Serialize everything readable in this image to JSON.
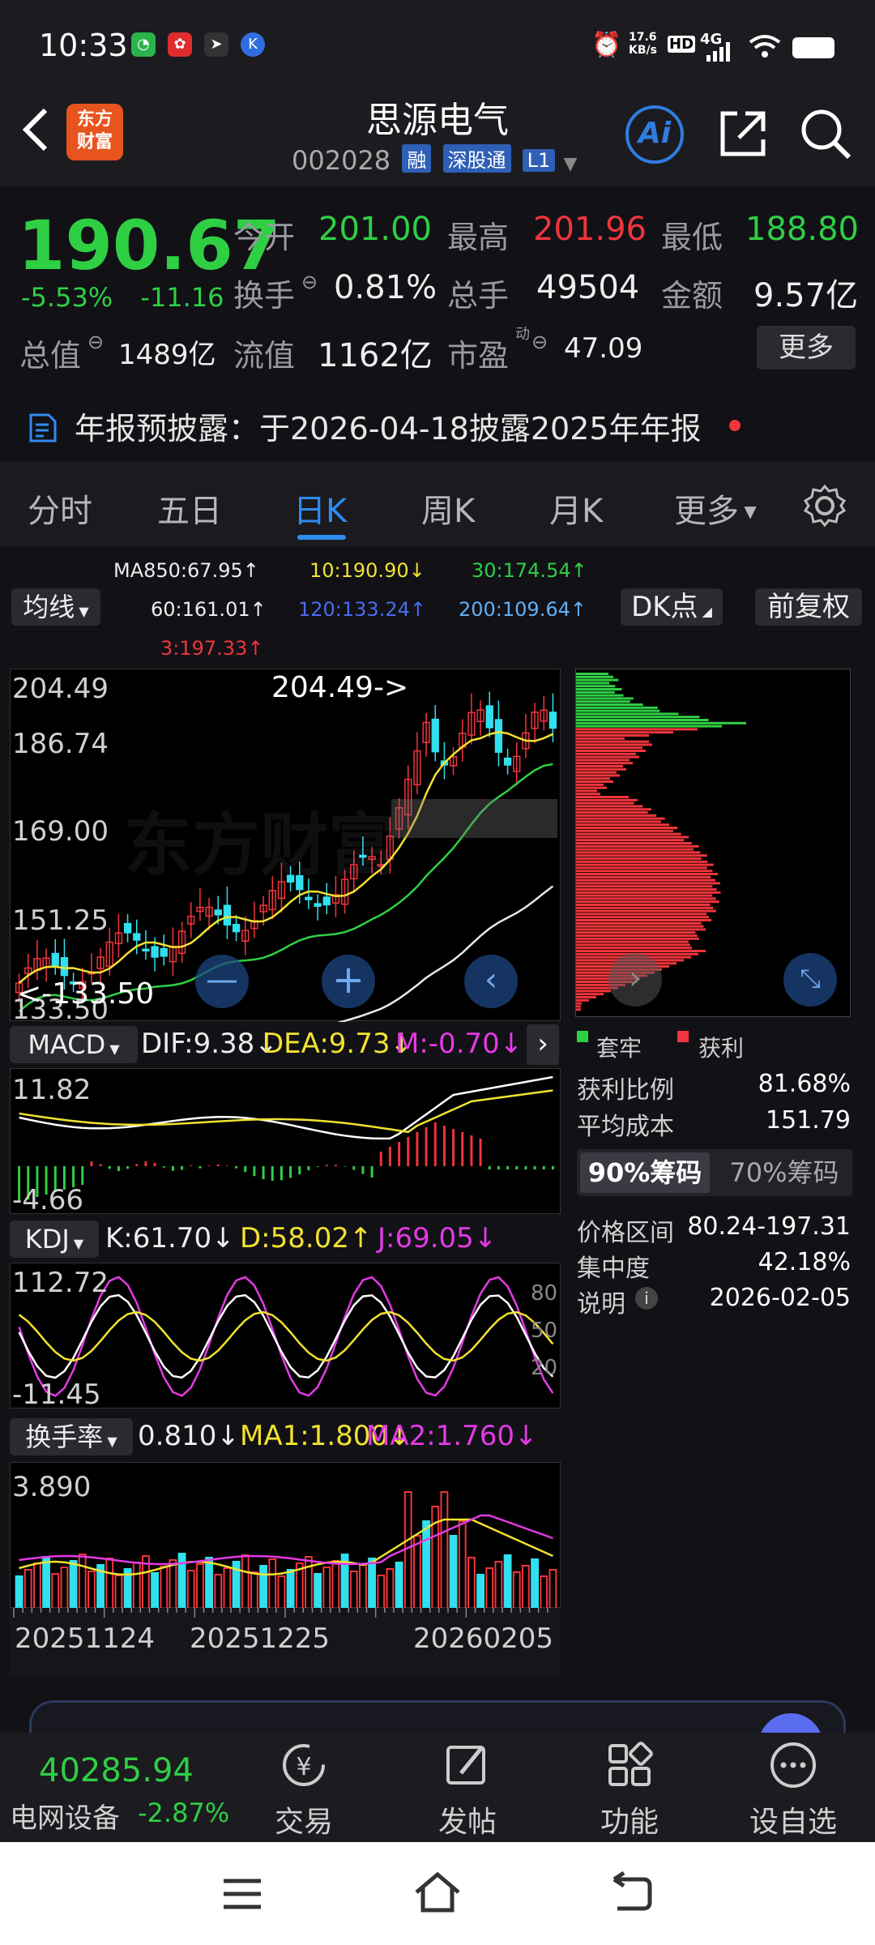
{
  "status_bar": {
    "time": "10:33",
    "net_speed": "17.6\nKB/s",
    "hd": "HD",
    "signal": "4G"
  },
  "header": {
    "logo_text": "东方\n财富",
    "title": "思源电气",
    "code": "002028",
    "tags": [
      "融",
      "深股通",
      "L1"
    ],
    "ai_label": "Ai"
  },
  "quote": {
    "price": "190.67",
    "change_pct": "-5.53%",
    "change_amt": "-11.16",
    "open_label": "今开",
    "open": "201.00",
    "high_label": "最高",
    "high": "201.96",
    "low_label": "最低",
    "low": "188.80",
    "turnover_label": "换手",
    "turnover": "0.81%",
    "volume_label": "总手",
    "volume": "49504",
    "amount_label": "金额",
    "amount": "9.57亿",
    "mktcap_label": "总值",
    "mktcap": "1489亿",
    "float_label": "流值",
    "float_cap": "1162亿",
    "pe_label": "市盈",
    "pe_sup": "动",
    "pe": "47.09",
    "more_label": "更多"
  },
  "announcement": {
    "text": "年报预披露：于2026-04-18披露2025年年报"
  },
  "tabs": [
    "分时",
    "五日",
    "日K",
    "周K",
    "月K",
    "更多"
  ],
  "active_tab": "日K",
  "ma_row": {
    "ma_select": "均线",
    "ma850": "MA850:67.95↑",
    "ma10": "10:190.90↓",
    "ma30": "30:174.54↑",
    "ma60": "60:161.01↑",
    "ma120": "120:133.24↑",
    "ma200": "200:109.64↑",
    "ma3": "3:197.33↑",
    "dk_label": "DK点",
    "adjust_label": "前复权"
  },
  "kline": {
    "y_labels": [
      "204.49",
      "186.74",
      "169.00",
      "151.25",
      "133.50"
    ],
    "max_marker": "204.49->",
    "min_marker": "<-133.50",
    "watermark": "东方财富"
  },
  "macd": {
    "name": "MACD",
    "dif": "DIF:9.38↓",
    "dea": "DEA:9.73↓",
    "m": "M:-0.70↓",
    "y_top": "11.82",
    "y_bottom": "-4.66"
  },
  "kdj": {
    "name": "KDJ",
    "k": "K:61.70↓",
    "d": "D:58.02↑",
    "j": "J:69.05↓",
    "y_top": "112.72",
    "y_bottom": "-11.45",
    "levels": [
      "80",
      "50",
      "20"
    ]
  },
  "turnover_ind": {
    "name": "换手率",
    "val": "0.810↓",
    "ma1": "MA1:1.800↓",
    "ma2": "MA2:1.760↓",
    "y_top": "3.890"
  },
  "dates": [
    "20251124",
    "20251225",
    "20260205"
  ],
  "chips": {
    "legend_trapped": "套牢",
    "legend_profit": "获利",
    "rows": [
      {
        "k": "获利比例",
        "v": "81.68%"
      },
      {
        "k": "平均成本",
        "v": "151.79"
      }
    ],
    "tab_90": "90%筹码",
    "tab_70": "70%筹码",
    "rows2": [
      {
        "k": "价格区间",
        "v": "80.24-197.31"
      },
      {
        "k": "集中度",
        "v": "42.18%"
      },
      {
        "k": "说明",
        "v": "2026-02-05"
      }
    ]
  },
  "bottom": {
    "index_value": "40285.94",
    "index_name": "电网设备",
    "index_chg": "-2.87%",
    "items": [
      "交易",
      "发帖",
      "功能",
      "设自选"
    ]
  },
  "colors": {
    "up": "#f0353c",
    "down": "#2fcf44",
    "cyan": "#31e0ee",
    "yellow": "#f2e230",
    "magenta": "#e43ae4",
    "accent": "#2f8cf0"
  }
}
